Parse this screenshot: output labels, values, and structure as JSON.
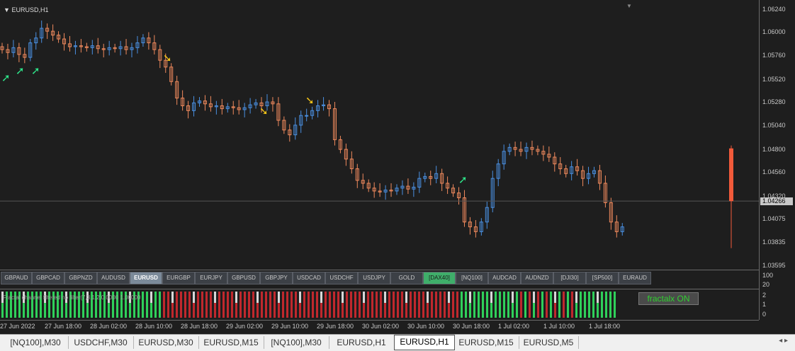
{
  "chart": {
    "title": "EURUSD,H1",
    "price_axis": [
      "1.06240",
      "1.06000",
      "1.05760",
      "1.05520",
      "1.05280",
      "1.05040",
      "1.04800",
      "1.04560",
      "1.04320",
      "1.04075",
      "1.03835",
      "1.03595"
    ],
    "current_price": "1.04266",
    "up_color": "#4a90e2",
    "down_color": "#f08a5d",
    "signal_up_color": "#2ee58a",
    "signal_down_color": "#f5c518",
    "large_bar_color": "#f25a3a"
  },
  "symbol_bar": {
    "buttons": [
      "GBPAUD",
      "GBPCAD",
      "GBPNZD",
      "AUDUSD",
      "EURUSD",
      "EURGBP",
      "EURJPY",
      "GBPUSD",
      "GBPJPY",
      "USDCAD",
      "USDCHF",
      "USDJPY",
      "GOLD",
      "[DAX40]",
      "[NQ100]",
      "AUDCAD",
      "AUDNZD",
      "[DJI30]",
      "[SP500]",
      "EURAUD"
    ],
    "active": "EURUSD",
    "highlight": "[DAX40]",
    "axis": [
      "100",
      "20"
    ]
  },
  "indicator": {
    "label": "Fractal channel filtered no filter(7,3,1,2,0.0000 1.00000",
    "fractal_button": "fractalx ON",
    "axis": [
      "2",
      "1",
      "0"
    ],
    "red": "#c0282d",
    "green": "#2fd05a"
  },
  "time_axis": [
    "27 Jun 2022",
    "27 Jun 18:00",
    "28 Jun 02:00",
    "28 Jun 10:00",
    "28 Jun 18:00",
    "29 Jun 02:00",
    "29 Jun 10:00",
    "29 Jun 18:00",
    "30 Jun 02:00",
    "30 Jun 10:00",
    "30 Jun 18:00",
    "1 Jul 02:00",
    "1 Jul 10:00",
    "1 Jul 18:00"
  ],
  "tabs": [
    "[NQ100],M30",
    "USDCHF,M30",
    "EURUSD,M30",
    "EURUSD,M15",
    "[NQ100],M30",
    "EURUSD,H1",
    "EURUSD,H1",
    "EURUSD,M15",
    "EURUSD,M5"
  ],
  "active_tab_index": 6
}
